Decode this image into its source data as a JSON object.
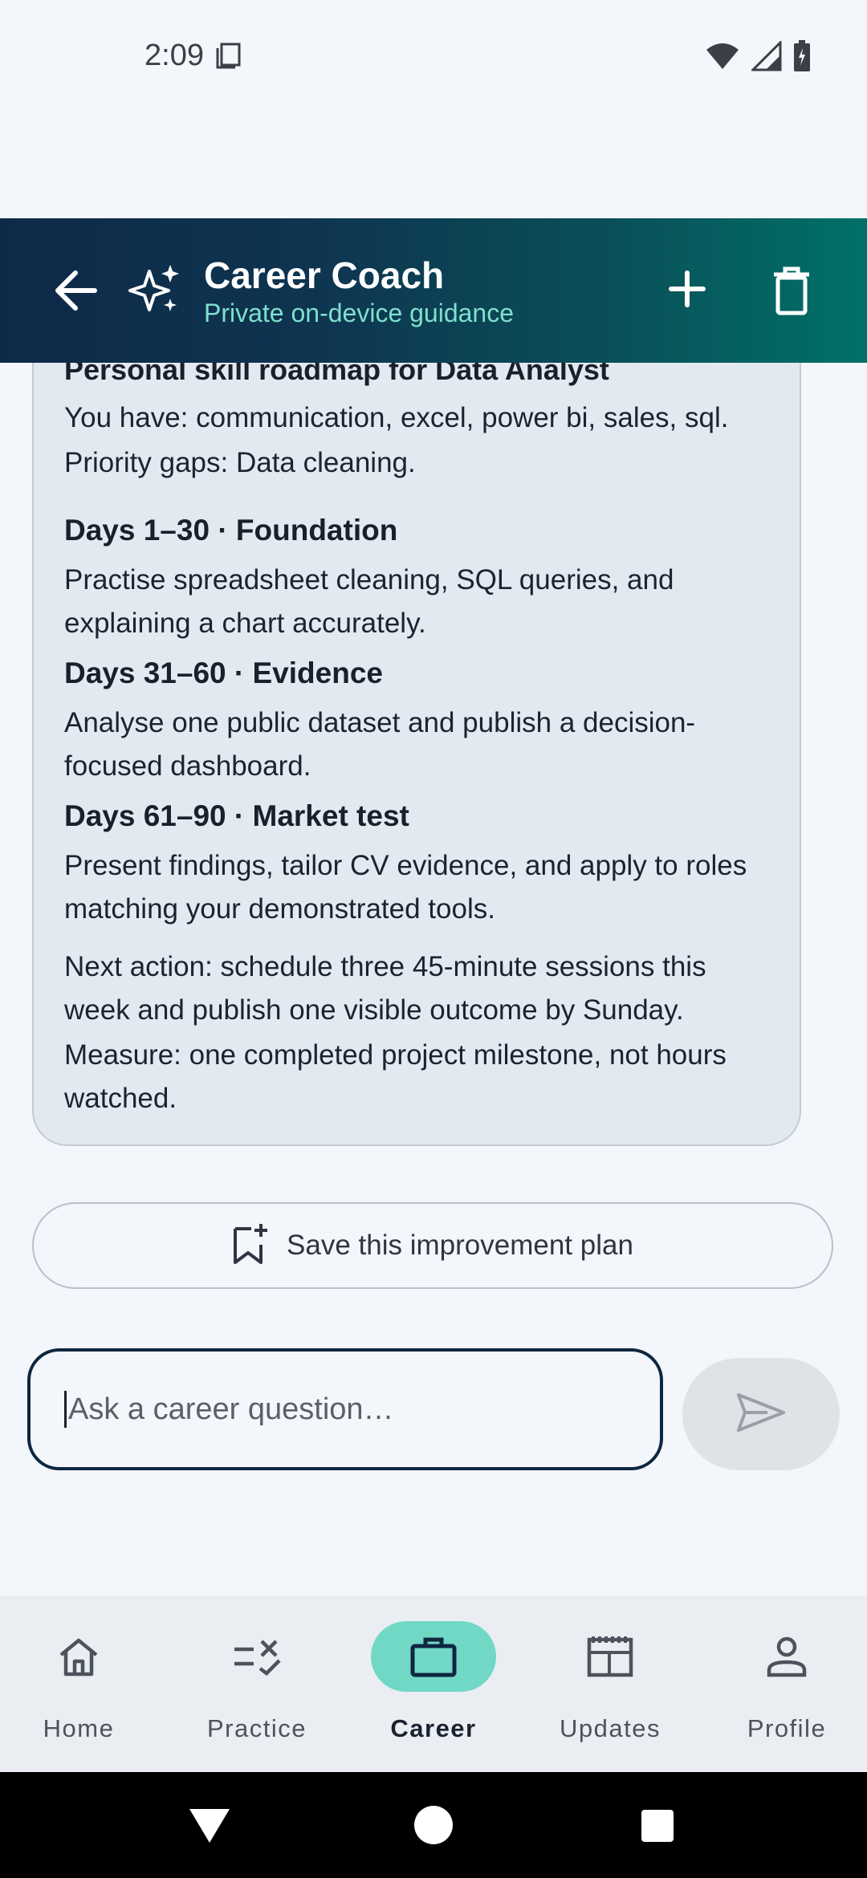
{
  "status_bar": {
    "time": "2:09"
  },
  "app_bar": {
    "title": "Career Coach",
    "subtitle": "Private on-device guidance"
  },
  "message": {
    "heading_clipped": "Personal skill roadmap for Data Analyst",
    "you_have": "You have: communication, excel, power bi, sales, sql.",
    "priority": "Priority gaps: Data cleaning.",
    "phases": [
      {
        "title": "Days 1–30 · Foundation",
        "text": "Practise spreadsheet cleaning, SQL queries, and explaining a chart accurately."
      },
      {
        "title": "Days 31–60 · Evidence",
        "text": "Analyse one public dataset and publish a decision-focused dashboard."
      },
      {
        "title": "Days 61–90 · Market test",
        "text": "Present findings, tailor CV evidence, and apply to roles matching your demonstrated tools."
      }
    ],
    "next_action": "Next action: schedule three 45-minute sessions this week and publish one visible outcome by Sunday.",
    "measure": "Measure: one completed project milestone, not hours watched."
  },
  "save_button": {
    "label": "Save this improvement plan"
  },
  "input": {
    "placeholder": "Ask a career question…"
  },
  "bottom_nav": {
    "items": [
      {
        "label": "Home",
        "icon": "home-icon"
      },
      {
        "label": "Practice",
        "icon": "practice-icon"
      },
      {
        "label": "Career",
        "icon": "briefcase-icon",
        "active": true
      },
      {
        "label": "Updates",
        "icon": "newspaper-icon"
      },
      {
        "label": "Profile",
        "icon": "person-icon"
      }
    ]
  },
  "colors": {
    "accent": "#71d8c6",
    "app_bar_start": "#0e2a47",
    "app_bar_end": "#007068",
    "subtitle": "#7fe0cd"
  }
}
